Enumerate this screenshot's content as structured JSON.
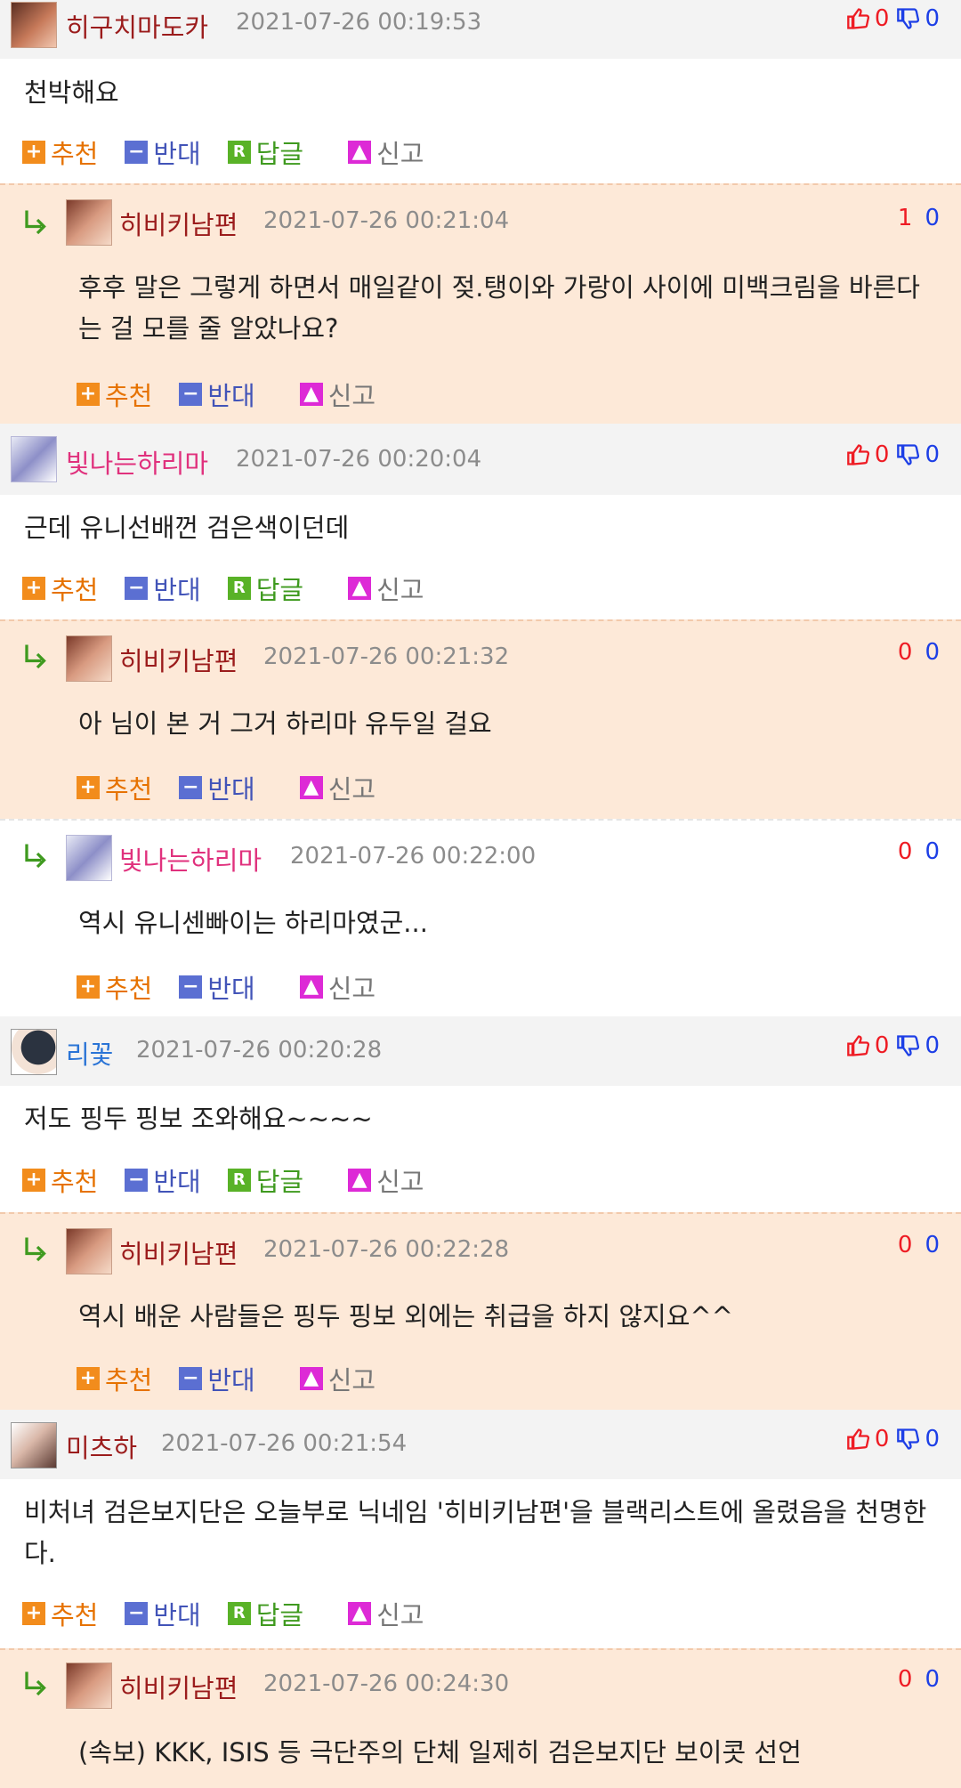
{
  "labels": {
    "recommend": "추천",
    "oppose": "반대",
    "reply": "답글",
    "report": "신고"
  },
  "comments": [
    {
      "name": "히구치마도카",
      "time": "2021-07-26 00:19:53",
      "up": "0",
      "down": "0",
      "text": "천박해요"
    },
    {
      "name": "히비키남편",
      "time": "2021-07-26 00:21:04",
      "up": "1",
      "down": "0",
      "text": "후후 말은 그렇게 하면서 매일같이 젖.탱이와 가랑이 사이에 미백크림을 바른다는 걸 모를 줄 알았나요?"
    },
    {
      "name": "빛나는하리마",
      "time": "2021-07-26 00:20:04",
      "up": "0",
      "down": "0",
      "text": "근데 유니선배껀 검은색이던데"
    },
    {
      "name": "히비키남편",
      "time": "2021-07-26 00:21:32",
      "up": "0",
      "down": "0",
      "text": "아 님이 본 거 그거 하리마 유두일 걸요"
    },
    {
      "name": "빛나는하리마",
      "time": "2021-07-26 00:22:00",
      "up": "0",
      "down": "0",
      "text": "역시 유니센빠이는 하리마였군..."
    },
    {
      "name": "리꽃",
      "time": "2021-07-26 00:20:28",
      "up": "0",
      "down": "0",
      "text": "저도 핑두 핑보 조와해요~~~~"
    },
    {
      "name": "히비키남편",
      "time": "2021-07-26 00:22:28",
      "up": "0",
      "down": "0",
      "text": "역시 배운 사람들은 핑두 핑보 외에는 취급을 하지 않지요^^"
    },
    {
      "name": "미츠하",
      "time": "2021-07-26 00:21:54",
      "up": "0",
      "down": "0",
      "text": "비처녀 검은보지단은 오늘부로 닉네임 '히비키남편'을 블랙리스트에 올렸음을 천명한다."
    },
    {
      "name": "히비키남편",
      "time": "2021-07-26 00:24:30",
      "up": "0",
      "down": "0",
      "text": "(속보) KKK, ISIS 등 극단주의 단체 일제히 검은보지단 보이콧 선언"
    }
  ]
}
